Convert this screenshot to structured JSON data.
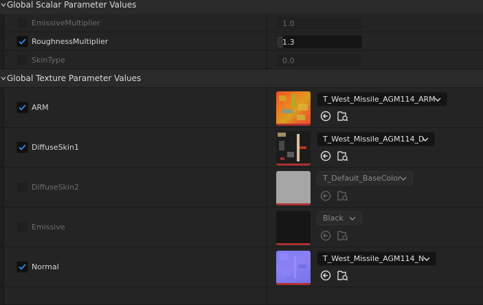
{
  "scalar_section": {
    "title": "Global Scalar Parameter Values",
    "params": [
      {
        "name": "EmissiveMultiplier",
        "enabled": false,
        "value": "1.0",
        "fill": 0.0
      },
      {
        "name": "RoughnessMultiplier",
        "enabled": true,
        "value": "1.3",
        "fill": 0.07
      },
      {
        "name": "SkinType",
        "enabled": false,
        "value": "0.0",
        "fill": 0.0
      }
    ]
  },
  "texture_section": {
    "title": "Global Texture Parameter Values",
    "params": [
      {
        "name": "ARM",
        "enabled": true,
        "texture": "T_West_Missile_AGM114_ARM"
      },
      {
        "name": "DiffuseSkin1",
        "enabled": true,
        "texture": "T_West_Missile_AGM114_D"
      },
      {
        "name": "DiffuseSkin2",
        "enabled": false,
        "texture": "T_Default_BaseColor"
      },
      {
        "name": "Emissive",
        "enabled": false,
        "texture": "Black"
      },
      {
        "name": "Normal",
        "enabled": true,
        "texture": "T_West_Missile_AGM114_N"
      }
    ]
  },
  "icons": {
    "collapse": "chevron-down-icon",
    "checkbox": "checkmark-icon",
    "combo": "chevron-down-icon",
    "use_selected": "use-selected-arrow-icon",
    "browse": "browse-folder-icon"
  },
  "colors": {
    "checkmark": "#2f8fe6",
    "panel": "#242424",
    "category": "#2a2a2a",
    "thumbnail_underline": "#b03030"
  }
}
